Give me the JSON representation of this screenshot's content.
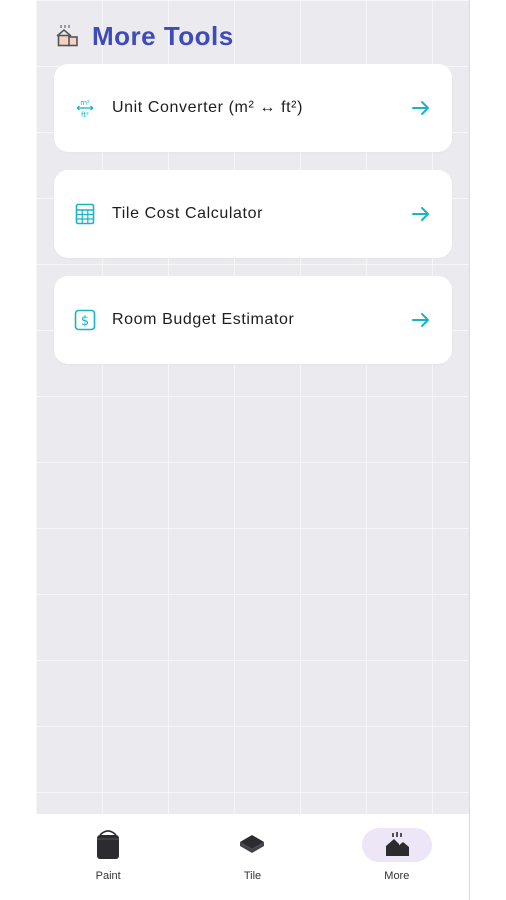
{
  "header": {
    "title": "More Tools",
    "icon": "house-tools-icon"
  },
  "tools": [
    {
      "label": "Unit Converter (m² ↔ ft²)",
      "icon": "unit-converter-icon"
    },
    {
      "label": "Tile Cost Calculator",
      "icon": "calculator-icon"
    },
    {
      "label": "Room Budget Estimator",
      "icon": "dollar-icon"
    }
  ],
  "nav": [
    {
      "label": "Paint",
      "icon": "paint-bucket-icon"
    },
    {
      "label": "Tile",
      "icon": "tile-icon"
    },
    {
      "label": "More",
      "icon": "more-icon",
      "active": true
    }
  ],
  "colors": {
    "accent": "#19b3c4",
    "title": "#3f4bb8",
    "active_nav": "#ece6f7"
  }
}
